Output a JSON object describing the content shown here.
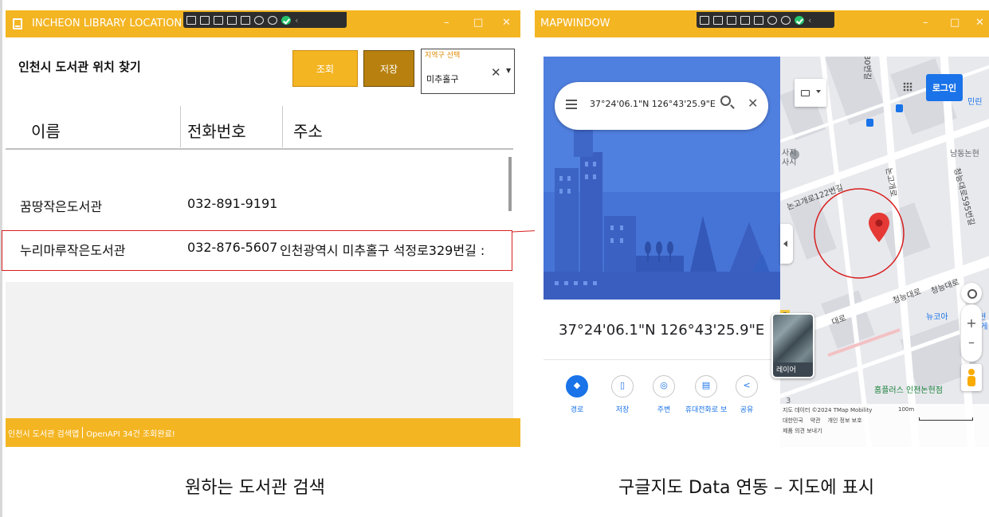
{
  "left_window": {
    "title": "INCHEON LIBRARY LOCATION",
    "heading": "인천시 도서관 위치 찾기",
    "search_button": "조회",
    "save_button": "저장",
    "district_label": "지역구 선택",
    "district_value": "미추홀구",
    "columns": [
      "이름",
      "전화번호",
      "주소"
    ],
    "rows": [
      {
        "name": "꿈땅작은도서관",
        "phone": "032-891-9191",
        "address": ""
      },
      {
        "name": "누리마루작은도서관",
        "phone": "032-876-5607",
        "address": "인천광역시 미추홀구 석정로329번길 :"
      }
    ],
    "status": [
      "인천시 도서관 검색앱",
      "OpenAPI 34건 조회완료!"
    ]
  },
  "right_window": {
    "title": "MAPWINDOW",
    "search_query": "37°24'06.1\"N 126°43'25.9\"E",
    "place_title": "37°24'06.1\"N 126°43'25.9\"E",
    "actions": [
      "경로",
      "저장",
      "주변",
      "휴대전화로 보",
      "공유"
    ],
    "login_button": "로그인",
    "layer_label": "레이어",
    "map_labels": {
      "top": "30번길",
      "top_right": "민린",
      "nb_right": "남동논현",
      "road1": "논고개로122번길",
      "road2": "논고개로",
      "road3": "청능대로595번길",
      "road4": "청능대로",
      "road5": "청능대로",
      "road6": "뉴코아",
      "road7": "논현",
      "road8": "웃게",
      "store": "홈플러스 인천논현점",
      "side1": "사지",
      "side2": "사시",
      "frag1": "대로",
      "frag2": "논현",
      "frag3": "3",
      "frag4": "3"
    },
    "footer": {
      "copyright": "지도 데이터 ©2024 TMap Mobility",
      "links": "대한민국    약관    개인 정보 보호",
      "feedback": "제품 의견 보내기",
      "scale": "100m"
    }
  },
  "captions": {
    "left": "원하는 도서관 검색",
    "right": "구글지도 Data 연동 – 지도에 표시"
  },
  "colors": {
    "accent": "#f4b523",
    "save": "#b8810f",
    "highlight": "#d81f1f",
    "map_blue": "#1a73e8",
    "pin": "#e53935"
  },
  "icons": [
    "window-icon",
    "search-icon",
    "close-icon",
    "menu-icon",
    "keyboard-icon",
    "apps-icon",
    "directions-icon",
    "bookmark-icon",
    "nearby-icon",
    "send-to-phone-icon",
    "share-icon",
    "location-pin-icon",
    "my-location-icon",
    "pegman-icon"
  ]
}
